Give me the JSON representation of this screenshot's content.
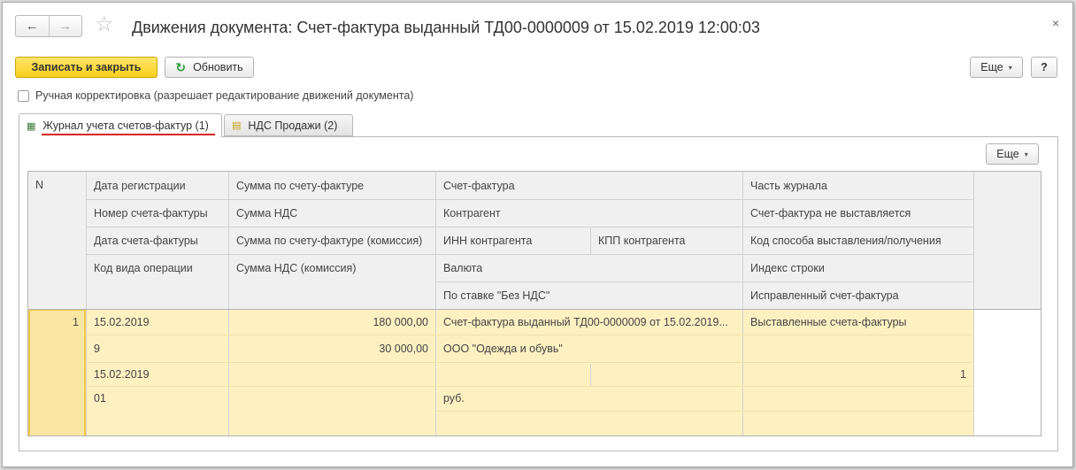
{
  "window": {
    "title": "Движения документа: Счет-фактура выданный ТД00-0000009 от 15.02.2019 12:00:03",
    "back_icon": "←",
    "forward_icon": "→",
    "star_icon": "☆",
    "close_icon": "×"
  },
  "toolbar": {
    "save_close": "Записать и закрыть",
    "refresh": "Обновить",
    "refresh_icon": "↻",
    "more": "Еще",
    "help": "?",
    "caret": "▾"
  },
  "manual_correction": {
    "label": "Ручная корректировка (разрешает редактирование движений документа)",
    "checked": false
  },
  "tabs": [
    {
      "label": "Журнал учета счетов-фактур (1)",
      "icon": "▦",
      "active": true
    },
    {
      "label": "НДС Продажи (2)",
      "icon": "▤",
      "active": false
    }
  ],
  "panel": {
    "more": "Еще"
  },
  "grid": {
    "headers": {
      "n": "N",
      "c1": [
        "Дата регистрации",
        "Номер счета-фактуры",
        "Дата счета-фактуры",
        "Код вида операции"
      ],
      "c2": [
        "Сумма по счету-фактуре",
        "Сумма НДС",
        "Сумма по счету-фактуре (комиссия)",
        "Сумма НДС (комиссия)"
      ],
      "c3": [
        "Счет-фактура",
        "Контрагент",
        "ИНН контрагента",
        "КПП контрагента",
        "Валюта",
        "По ставке \"Без НДС\""
      ],
      "c4": [
        "Часть журнала",
        "Счет-фактура не выставляется",
        "Код способа выставления/получения",
        "Индекс строки",
        "Исправленный счет-фактура"
      ]
    },
    "row": {
      "n": "1",
      "c1": [
        "15.02.2019",
        "9",
        "15.02.2019",
        "01"
      ],
      "c2": [
        "180 000,00",
        "30 000,00",
        "",
        ""
      ],
      "c3_invoice": "Счет-фактура выданный ТД00-0000009 от 15.02.2019...",
      "c3_counterparty": "ООО \"Одежда и обувь\"",
      "c3_currency": "руб.",
      "c4_part": "Выставленные счета-фактуры",
      "c4_code": "1"
    }
  }
}
